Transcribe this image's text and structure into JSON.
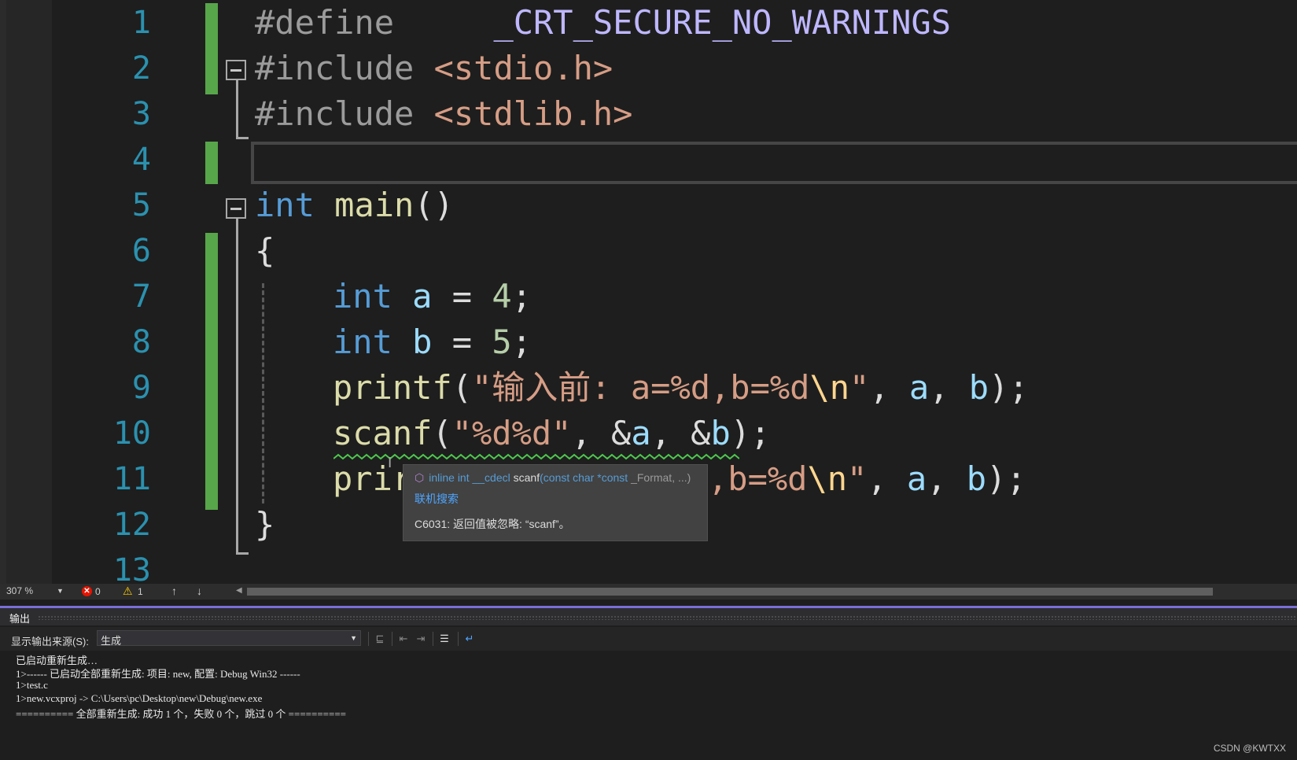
{
  "editor": {
    "line_numbers": [
      "1",
      "2",
      "3",
      "4",
      "5",
      "6",
      "7",
      "8",
      "9",
      "10",
      "11",
      "12",
      "13"
    ],
    "code": {
      "l1": {
        "directive": "#define",
        "macro": "_CRT_SECURE_NO_WARNINGS"
      },
      "l2": {
        "directive": "#include",
        "header": "<stdio.h>"
      },
      "l3": {
        "directive": "#include",
        "header": "<stdlib.h>"
      },
      "l5": {
        "type": "int",
        "name": "main",
        "parens": "()"
      },
      "l6": {
        "brace": "{"
      },
      "l7": {
        "type": "int",
        "var": "a",
        "eq": "=",
        "num": "4",
        "semi": ";"
      },
      "l8": {
        "type": "int",
        "var": "b",
        "eq": "=",
        "num": "5",
        "semi": ";"
      },
      "l9": {
        "fn": "printf",
        "open": "(",
        "str1": "\"输入前: a=%d,b=%d",
        "esc": "\\n",
        "str2": "\"",
        "sep1": ", ",
        "arg1": "a",
        "sep2": ", ",
        "arg2": "b",
        "close": ");"
      },
      "l10": {
        "fn": "scanf",
        "open": "(",
        "str": "\"%d%d\"",
        "sep1": ", &",
        "arg1": "a",
        "sep2": ", &",
        "arg2": "b",
        "close": ");"
      },
      "l11": {
        "fn_visible": "prir",
        "str_visible": ",b=%d",
        "esc": "\\n",
        "str2": "\"",
        "sep1": ", ",
        "arg1": "a",
        "sep2": ", ",
        "arg2": "b",
        "close": ");"
      },
      "l12": {
        "brace": "}"
      }
    }
  },
  "tooltip": {
    "icon": "cube-icon",
    "sig_kw": "inline int __cdecl",
    "sig_fn": "scanf",
    "sig_params_open": "(",
    "sig_p1_kw": "const char",
    "sig_p1_rest": " *",
    "sig_p1_kw2": "const",
    "sig_p1_name": " _Format, ...)",
    "link": "联机搜索",
    "message": "C6031: 返回值被忽略: “scanf”。"
  },
  "status_bar": {
    "zoom": "307 %",
    "errors": "0",
    "warnings": "1"
  },
  "output": {
    "title": "输出",
    "source_label": "显示输出来源(S):",
    "source_value": "生成",
    "lines": [
      "已启动重新生成…",
      "1>------ 已启动全部重新生成: 项目: new, 配置: Debug Win32 ------",
      "1>test.c",
      "1>new.vcxproj -> C:\\Users\\pc\\Desktop\\new\\Debug\\new.exe",
      "========== 全部重新生成: 成功 1 个，失败 0 个，跳过 0 个 =========="
    ]
  },
  "watermark": "CSDN @KWTXX",
  "colors": {
    "keyword": "#569cd6",
    "string": "#d69d85",
    "function": "#dcdcaa",
    "variable": "#9cdcfe",
    "number": "#b5cea8",
    "change_bar": "#57a64a",
    "accent": "#7a6fd6"
  }
}
